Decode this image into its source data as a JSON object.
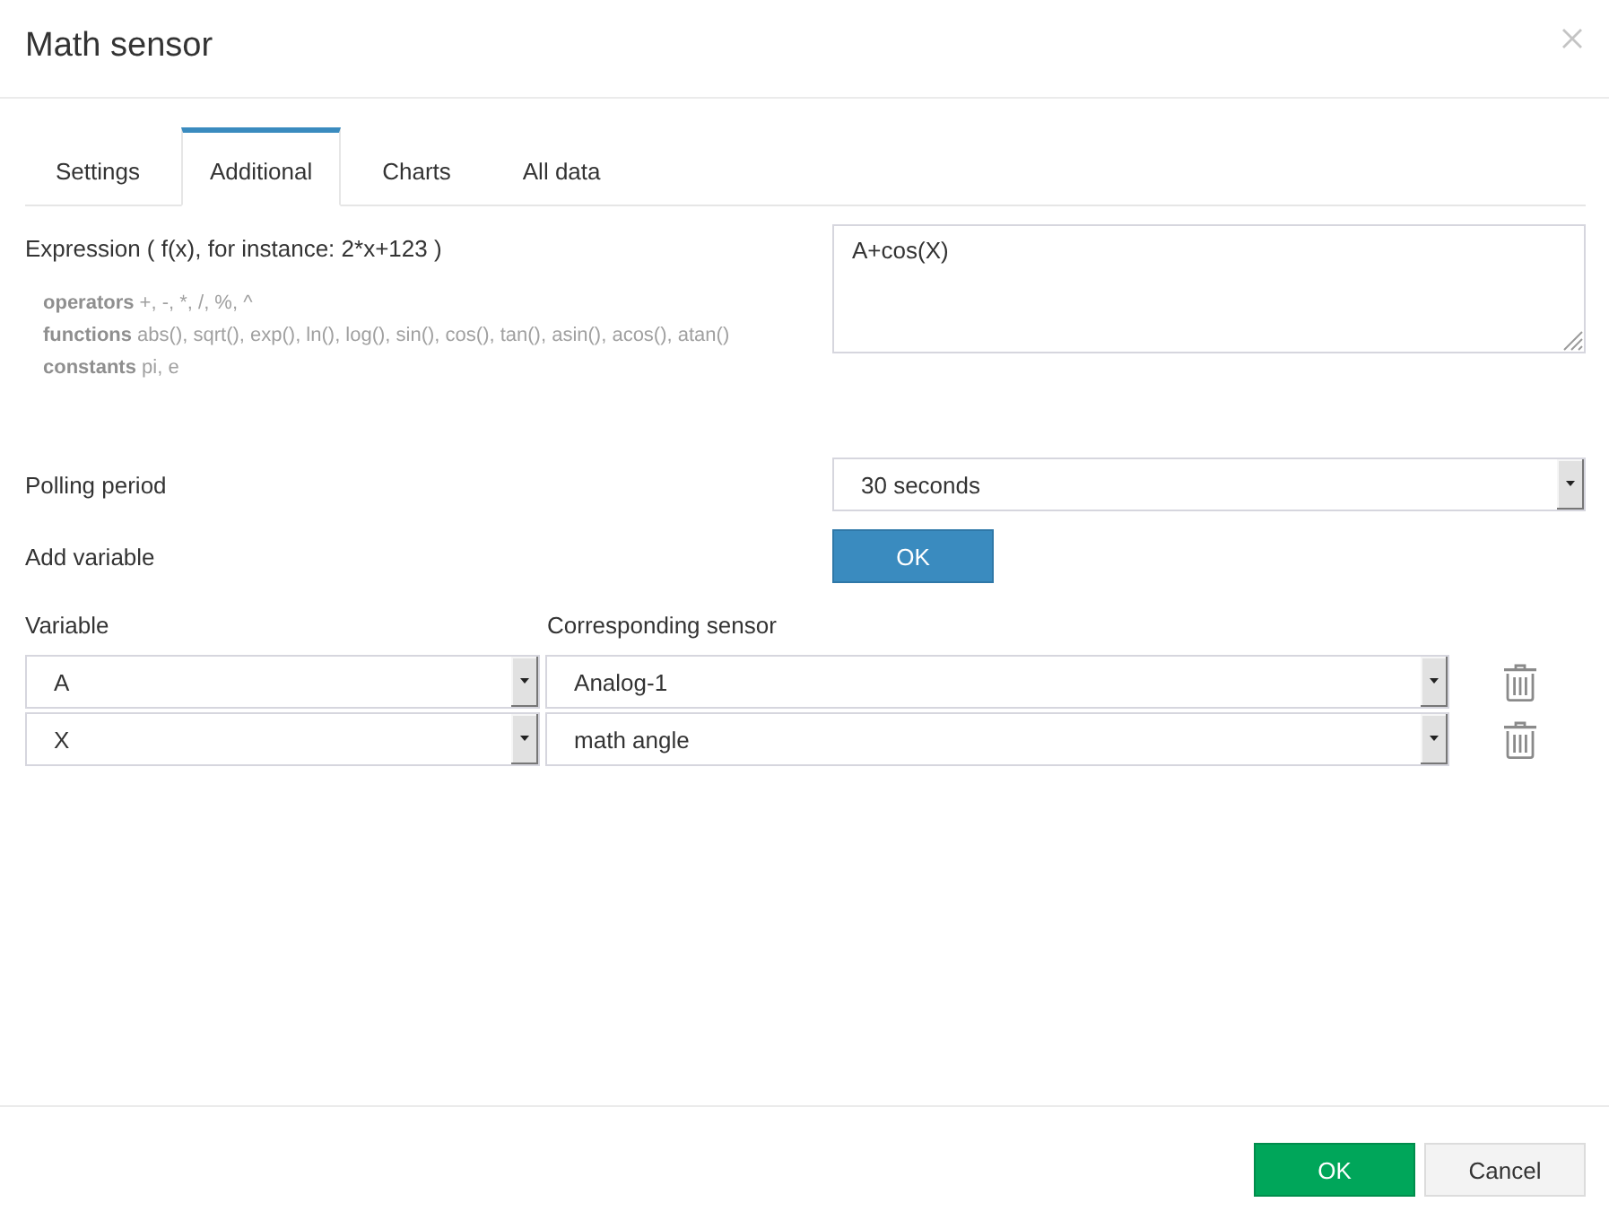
{
  "window": {
    "title": "Math sensor"
  },
  "tabs": [
    {
      "label": "Settings",
      "selected": false
    },
    {
      "label": "Additional",
      "selected": true
    },
    {
      "label": "Charts",
      "selected": false
    },
    {
      "label": "All data",
      "selected": false
    }
  ],
  "expression": {
    "label": "Expression ( f(x), for instance: 2*x+123 )",
    "hints": [
      "**operators** +, -, *, /, %, ^",
      "**functions** abs(), sqrt(), exp(), ln(), log(), sin(), cos(), tan(), asin(), acos(), atan()",
      "**constants** pi, e"
    ],
    "value": "A+cos(X)"
  },
  "polling_period": {
    "label": "Polling period",
    "value": "30 seconds"
  },
  "add_variable": {
    "label": "Add variable",
    "button": "OK"
  },
  "variables": {
    "columns": [
      "Variable",
      "Corresponding sensor"
    ],
    "rows": [
      {
        "variable": "A",
        "sensor": "Analog-1"
      },
      {
        "variable": "X",
        "sensor": "math angle"
      }
    ]
  },
  "footer": {
    "buttons": [
      {
        "label": "OK",
        "kind": "primary"
      },
      {
        "label": "Cancel",
        "kind": "secondary"
      }
    ]
  }
}
